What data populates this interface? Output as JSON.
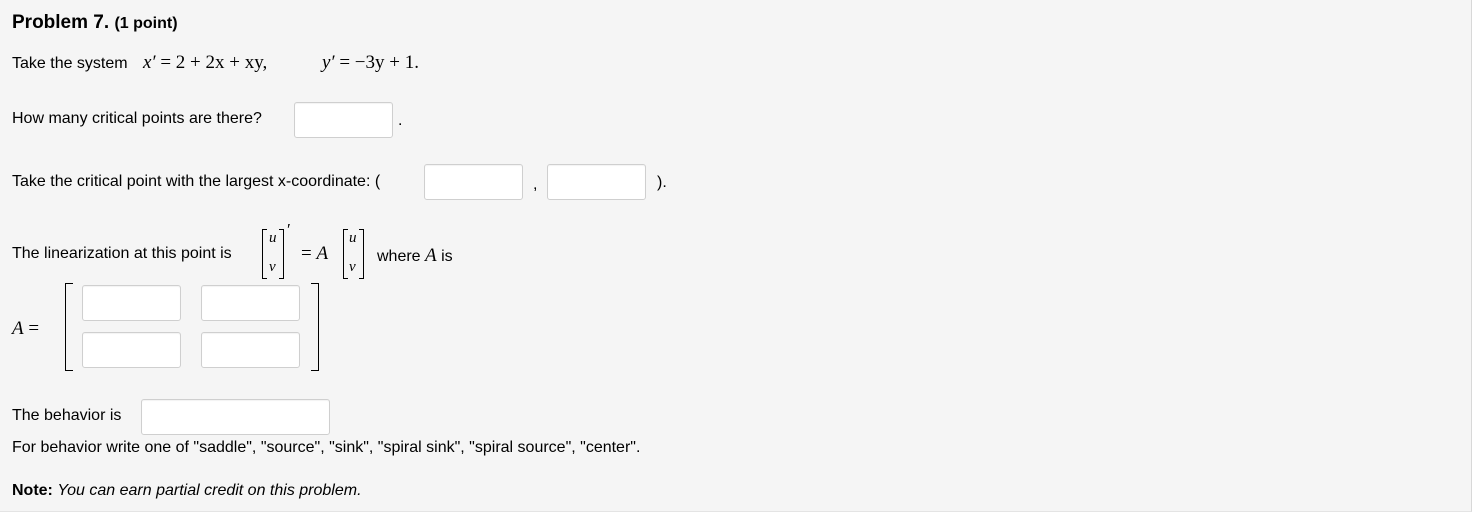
{
  "problem": {
    "title": "Problem 7.",
    "points": "(1 point)"
  },
  "system": {
    "prefix": "Take the system",
    "eq_x_lhs": "x′",
    "eq_x_rhs": "= 2 + 2x + xy,",
    "eq_y_lhs": "y′",
    "eq_y_rhs": "= −3y + 1."
  },
  "q1": {
    "text": "How many critical points are there?",
    "suffix": ".",
    "value": ""
  },
  "q2": {
    "text": "Take the critical point with the largest x-coordinate: (",
    "comma": ",",
    "close": ").",
    "x_value": "",
    "y_value": ""
  },
  "linearization": {
    "prefix": "The linearization at this point is",
    "u": "u",
    "v": "v",
    "prime": "′",
    "eq": "= A",
    "suffix_where": "where",
    "suffix_A": "A",
    "suffix_is": "is"
  },
  "matrix": {
    "label": "A =",
    "a11": "",
    "a12": "",
    "a21": "",
    "a22": ""
  },
  "behavior": {
    "label": "The behavior is",
    "value": "",
    "instructions": "For behavior write one of \"saddle\", \"source\", \"sink\", \"spiral sink\", \"spiral source\", \"center\"."
  },
  "note": {
    "label": "Note:",
    "text": "You can earn partial credit on this problem."
  }
}
